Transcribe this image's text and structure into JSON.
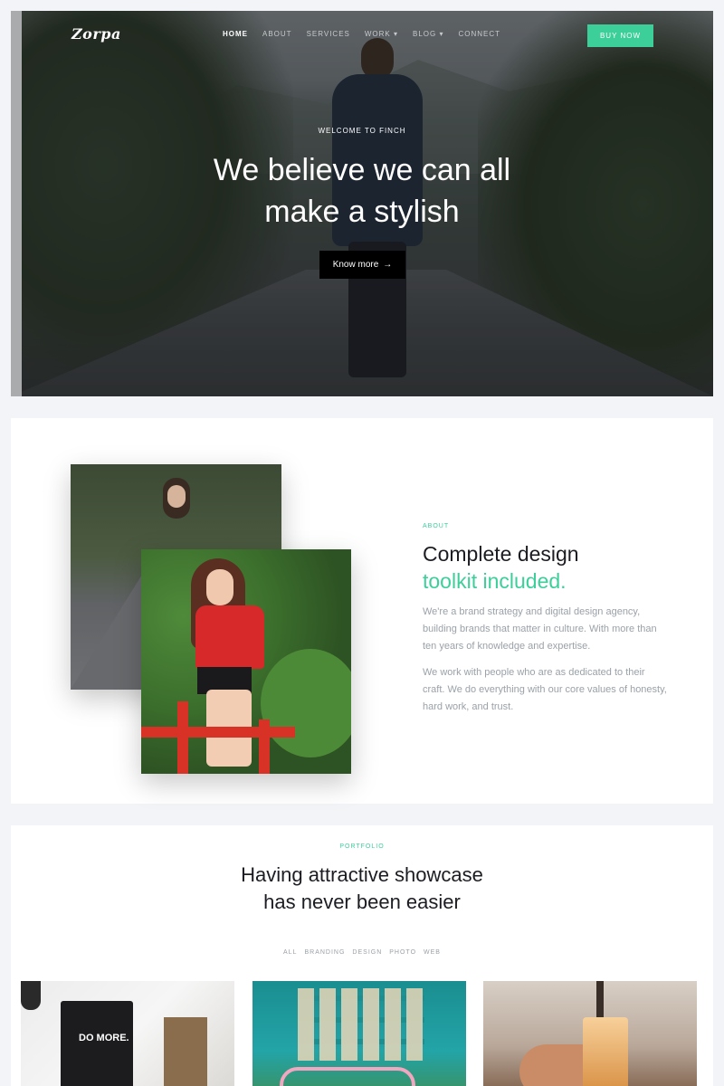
{
  "nav": {
    "logo": "Zorpa",
    "items": [
      {
        "label": "HOME"
      },
      {
        "label": "ABOUT"
      },
      {
        "label": "SERVICES"
      },
      {
        "label": "WORK ▾"
      },
      {
        "label": "BLOG ▾"
      },
      {
        "label": "CONNECT"
      }
    ],
    "buy_label": "BUY NOW"
  },
  "hero": {
    "eyebrow": "WELCOME TO FINCH",
    "title_line1": "We believe we can all",
    "title_line2": "make a stylish",
    "button_label": "Know more",
    "button_arrow": "→"
  },
  "about": {
    "eyebrow": "ABOUT",
    "title": "Complete design",
    "title_accent": "toolkit included.",
    "paragraph1": "We're a brand strategy and digital design agency, building brands that matter in culture. With more than ten years of knowledge and expertise.",
    "paragraph2": "We work with people who are as dedicated to their craft. We do everything with our core values of honesty, hard work, and trust."
  },
  "portfolio": {
    "eyebrow": "PORTFOLIO",
    "title_line1": "Having attractive showcase",
    "title_line2": "has never been easier",
    "filters": [
      "ALL",
      "BRANDING",
      "DESIGN",
      "PHOTO",
      "WEB"
    ],
    "card1_text": "DO MORE."
  },
  "colors": {
    "accent": "#3ccf9a",
    "dark": "#1c1d22",
    "muted": "#9aa1a8"
  }
}
